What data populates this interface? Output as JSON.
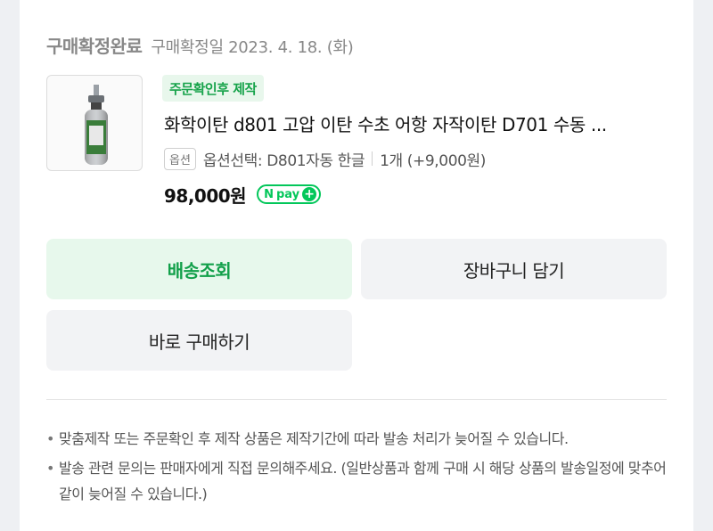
{
  "order": {
    "status": "구매확정완료",
    "confirm_date": "구매확정일 2023. 4. 18. (화)"
  },
  "product": {
    "image_alt": "product-image",
    "tag": "주문확인후 제작",
    "title": "화학이탄 d801 고압 이탄 수초 어항 자작이탄 D701 수동 ...",
    "option_badge": "옵션",
    "option_text": "옵션선택: D801자동 한글",
    "quantity_text": "1개 (+9,000원)",
    "price": "98,000원",
    "npay_label": "pay"
  },
  "buttons": {
    "track_label": "배송조회",
    "cart_label": "장바구니 담기",
    "buy_label": "바로 구매하기"
  },
  "notes": [
    "맞춤제작 또는 주문확인 후 제작 상품은 제작기간에 따라 발송 처리가 늦어질 수 있습니다.",
    "발송 관련 문의는 판매자에게 직접 문의해주세요. (일반상품과 함께 구매 시 해당 상품의 발송일정에 맞추어 같이 늦어질 수 있습니다.)"
  ],
  "colors": {
    "accent_green": "#03c75a",
    "track_button_bg": "#e7f8ec",
    "neutral_button_bg": "#f2f3f5"
  }
}
